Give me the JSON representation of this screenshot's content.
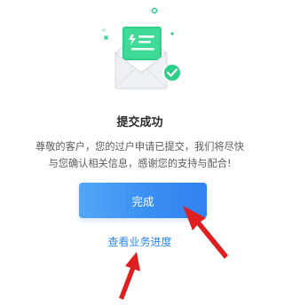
{
  "result": {
    "title": "提交成功",
    "message_line1": "尊敬的客户，您的过户申请已提交，我们将尽快",
    "message_line2": "与您确认相关信息，感谢您的支持与配合!"
  },
  "actions": {
    "done_label": "完成",
    "progress_link": "查看业务进度"
  },
  "colors": {
    "accent_blue": "#3a8ff2",
    "success_green": "#2ed089",
    "annotation_red": "#e02020"
  },
  "icons": {
    "illustration": "envelope-success-icon",
    "check": "check-circle-icon"
  }
}
